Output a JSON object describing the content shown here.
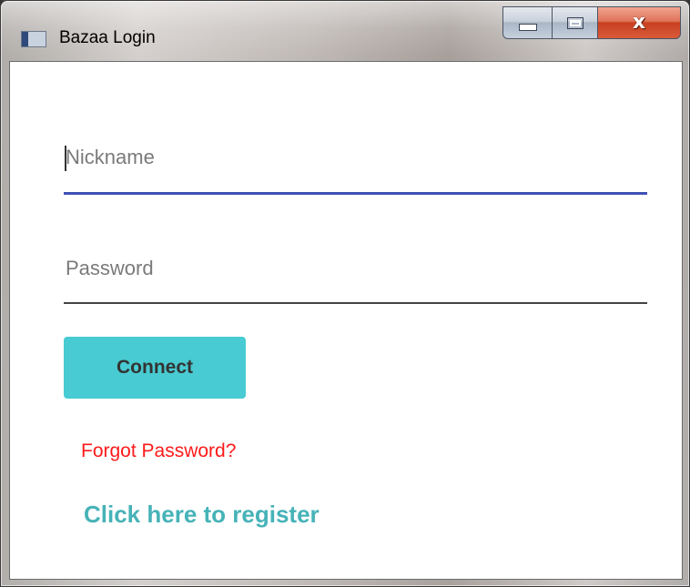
{
  "window": {
    "title": "Bazaa Login",
    "controls": {
      "minimize_icon": "minimize-icon",
      "maximize_icon": "maximize-icon",
      "close_glyph": "x"
    }
  },
  "form": {
    "nickname": {
      "placeholder": "Nickname",
      "value": ""
    },
    "password": {
      "placeholder": "Password",
      "value": ""
    },
    "connect_label": "Connect",
    "forgot_label": "Forgot Password?",
    "register_label": "Click here to register"
  },
  "colors": {
    "accent_underline": "#3f51b5",
    "button_bg": "#48cbd2",
    "forgot": "#ff1a1a",
    "register": "#46b3b8"
  }
}
